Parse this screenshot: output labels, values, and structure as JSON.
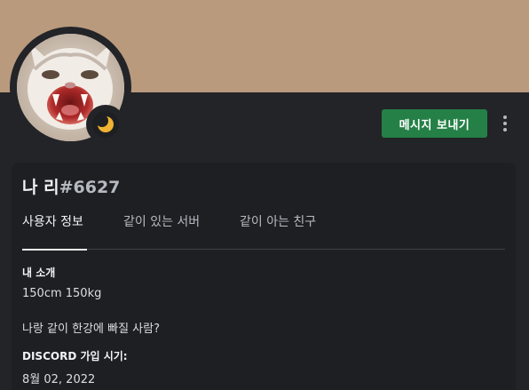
{
  "profile": {
    "display_name": "나 리",
    "discriminator": "#6627",
    "avatar_icon": "cat-avatar-icon",
    "status_icon": "moon-idle-icon",
    "status_color": "#f0b232",
    "banner_color": "#b99a7d"
  },
  "actions": {
    "send_message_label": "메시지 보내기",
    "more_icon": "more-vertical-icon",
    "accent": "#248046"
  },
  "tabs": [
    {
      "label": "사용자 정보",
      "active": true
    },
    {
      "label": "같이 있는 서버",
      "active": false
    },
    {
      "label": "같이 아는 친구",
      "active": false
    }
  ],
  "about": {
    "heading": "내 소개",
    "lines": [
      "150cm 150kg",
      "나랑 같이 한강에 빠질 사람?"
    ]
  },
  "member_since": {
    "heading": "DISCORD 가입 시기:",
    "date": "8월 02, 2022"
  }
}
